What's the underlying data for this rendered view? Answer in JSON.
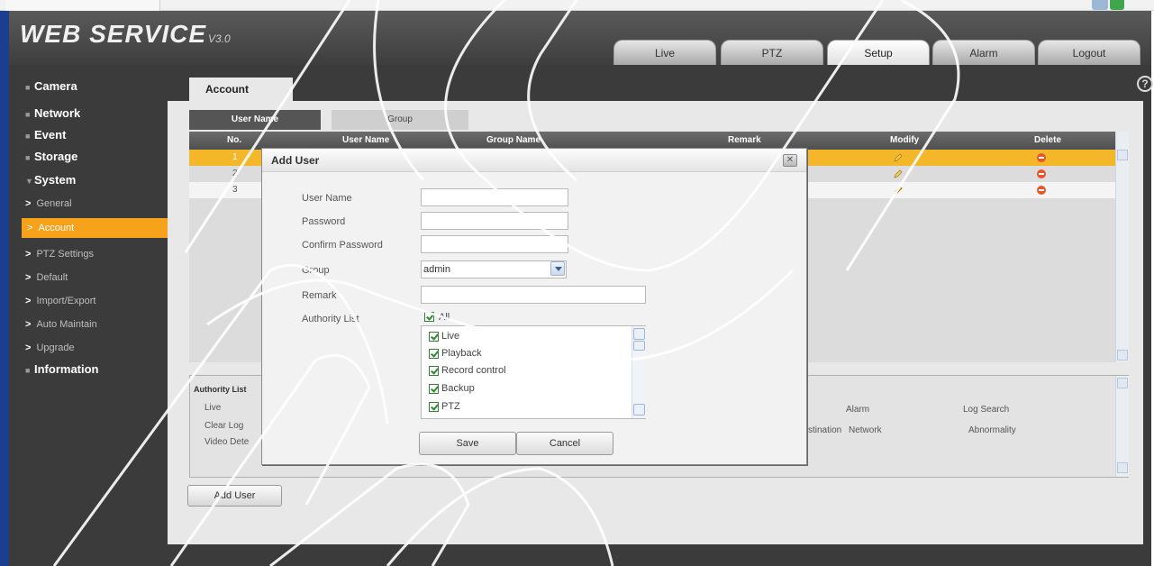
{
  "header": {
    "logo_text": "WEB  SERVICE",
    "logo_version": "V3.0",
    "nav_tabs": [
      {
        "label": "Live"
      },
      {
        "label": "PTZ"
      },
      {
        "label": "Setup",
        "active": true
      },
      {
        "label": "Alarm"
      },
      {
        "label": "Logout"
      }
    ]
  },
  "sidebar": {
    "items": [
      {
        "label": "Camera"
      },
      {
        "label": "Network"
      },
      {
        "label": "Event"
      },
      {
        "label": "Storage"
      },
      {
        "label": "System",
        "expanded": true
      }
    ],
    "system_sub": [
      {
        "label": "General"
      },
      {
        "label": "Account",
        "selected": true
      },
      {
        "label": "PTZ Settings"
      },
      {
        "label": "Default"
      },
      {
        "label": "Import/Export"
      },
      {
        "label": "Auto Maintain"
      },
      {
        "label": "Upgrade"
      }
    ],
    "information": {
      "label": "Information"
    }
  },
  "content": {
    "page_tab": "Account",
    "sub_tabs": [
      {
        "label": "User Name",
        "active": true
      },
      {
        "label": "Group"
      }
    ],
    "table": {
      "headers": [
        "No.",
        "User Name",
        "Group Name",
        "Remark",
        "Modify",
        "Delete"
      ],
      "rows": [
        {
          "no": "1",
          "selected": true
        },
        {
          "no": "2"
        },
        {
          "no": "3"
        }
      ]
    },
    "authority_panel": {
      "title": "Authority List",
      "left_items": [
        "Live",
        "Clear Log",
        "Video Dete"
      ],
      "right_items": [
        {
          "text": "Alarm"
        },
        {
          "text": "Log Search"
        },
        {
          "text": "stination"
        },
        {
          "text": "Network"
        },
        {
          "text": "Abnormality"
        }
      ]
    },
    "add_user_button": "Add User"
  },
  "dialog": {
    "title": "Add User",
    "close_glyph": "✕",
    "fields": {
      "user_name_label": "User Name",
      "user_name_value": "",
      "password_label": "Password",
      "password_value": "",
      "confirm_label": "Confirm Password",
      "confirm_value": "",
      "group_label": "Group",
      "group_value": "admin",
      "remark_label": "Remark",
      "remark_value": "",
      "authority_label": "Authority List"
    },
    "authority_all": {
      "label": "All",
      "checked": true
    },
    "authority_items": [
      {
        "label": "Live",
        "checked": true
      },
      {
        "label": "Playback",
        "checked": true
      },
      {
        "label": "Record control",
        "checked": true
      },
      {
        "label": "Backup",
        "checked": true
      },
      {
        "label": "PTZ",
        "checked": true
      }
    ],
    "save_label": "Save",
    "cancel_label": "Cancel"
  },
  "colors": {
    "header_dark": "#3e3e3e",
    "accent_orange": "#f7a21b",
    "selected_row": "#f5b72a",
    "delete_red": "#e8542b",
    "frame_blue": "#1b3e8f"
  }
}
